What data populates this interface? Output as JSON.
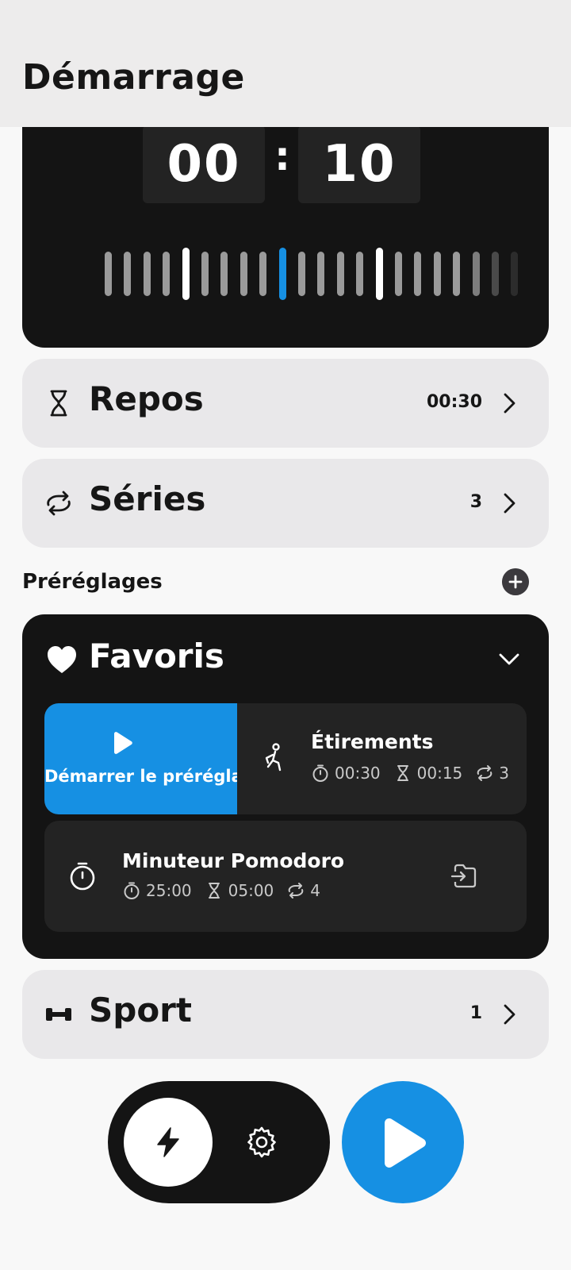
{
  "header": {
    "title": "Démarrage"
  },
  "timer": {
    "minutes": "00",
    "separator": ":",
    "seconds": "10"
  },
  "rows": {
    "rest": {
      "label": "Repos",
      "value": "00:30",
      "icon": "hourglass-icon"
    },
    "sets": {
      "label": "Séries",
      "value": "3",
      "icon": "repeat-icon"
    },
    "sport": {
      "label": "Sport",
      "value": "1",
      "icon": "dumbbell-icon"
    }
  },
  "presets": {
    "section_label": "Préréglages",
    "favorites": {
      "title": "Favoris",
      "items": [
        {
          "swipe_action": "Démarrer le préréglage",
          "name": "Étirements",
          "work": "00:30",
          "rest": "00:15",
          "sets": "3",
          "icon": "stretching-person-icon"
        },
        {
          "name": "Minuteur Pomodoro",
          "work": "25:00",
          "rest": "05:00",
          "sets": "4",
          "icon": "stopwatch-icon",
          "action_icon": "move-to-folder-icon"
        }
      ]
    }
  },
  "colors": {
    "accent": "#1690e3",
    "dark_card": "#141414",
    "light_card": "#e9e8ea"
  }
}
